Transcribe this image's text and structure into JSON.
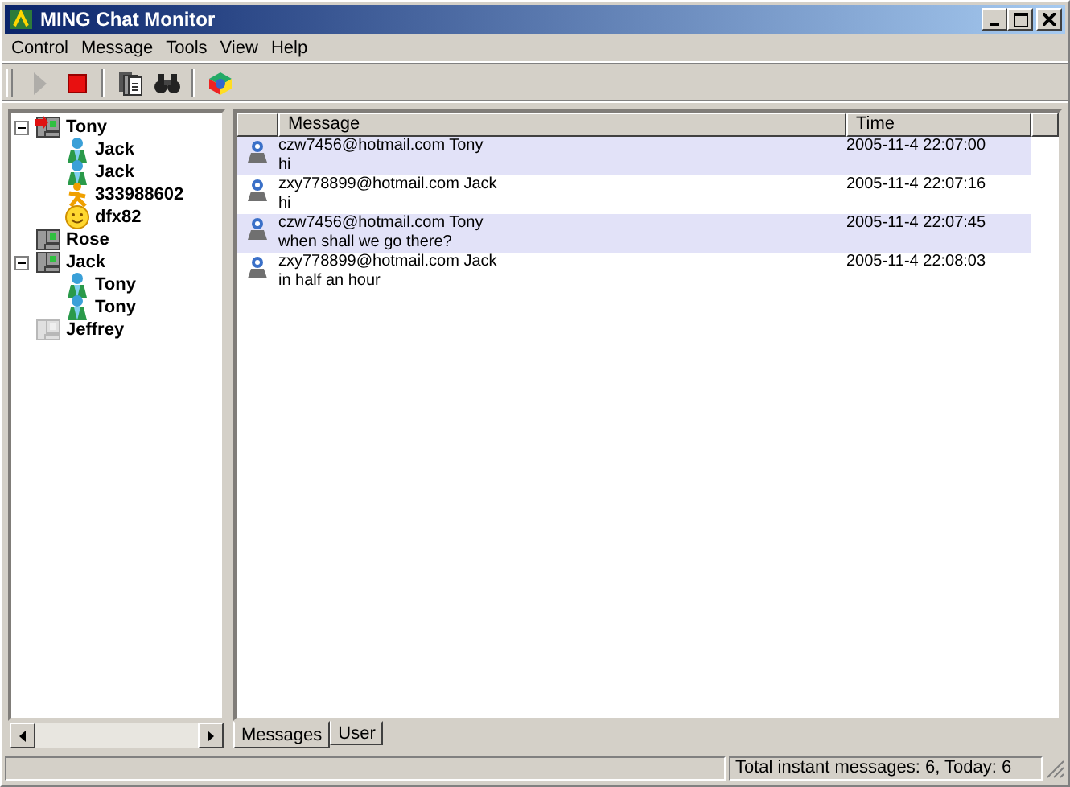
{
  "window": {
    "title": "MING Chat Monitor"
  },
  "menu": [
    "Control",
    "Message",
    "Tools",
    "View",
    "Help"
  ],
  "toolbar": [
    {
      "kind": "play",
      "disabled": true
    },
    {
      "kind": "stop",
      "disabled": false
    },
    {
      "kind": "sep"
    },
    {
      "kind": "pages",
      "disabled": false
    },
    {
      "kind": "find",
      "disabled": false
    },
    {
      "kind": "sep"
    },
    {
      "kind": "cube",
      "disabled": false
    }
  ],
  "tree": [
    {
      "label": "Tony",
      "kind": "station",
      "alert": true,
      "offline": false,
      "expanded": true,
      "children": [
        {
          "label": "Jack",
          "kind": "msn"
        },
        {
          "label": "Jack",
          "kind": "msn"
        },
        {
          "label": "333988602",
          "kind": "aim"
        },
        {
          "label": "dfx82",
          "kind": "smiley"
        }
      ]
    },
    {
      "label": "Rose",
      "kind": "station",
      "alert": false,
      "offline": false
    },
    {
      "label": "Jack",
      "kind": "station",
      "alert": false,
      "offline": false,
      "expanded": true,
      "children": [
        {
          "label": "Tony",
          "kind": "msn"
        },
        {
          "label": "Tony",
          "kind": "msn"
        }
      ]
    },
    {
      "label": "Jeffrey",
      "kind": "station",
      "alert": false,
      "offline": true
    }
  ],
  "table": {
    "columns": [
      "Message",
      "Time"
    ],
    "rows": [
      {
        "sender": "czw7456@hotmail.com Tony",
        "text": "hi",
        "time": "2005-11-4 22:07:00"
      },
      {
        "sender": "zxy778899@hotmail.com Jack",
        "text": "hi",
        "time": "2005-11-4 22:07:16"
      },
      {
        "sender": "czw7456@hotmail.com Tony",
        "text": "when shall we go there?",
        "time": "2005-11-4 22:07:45"
      },
      {
        "sender": "zxy778899@hotmail.com Jack",
        "text": "in half an hour",
        "time": "2005-11-4 22:08:03"
      }
    ]
  },
  "tabs": [
    {
      "label": "Messages",
      "selected": true
    },
    {
      "label": "User",
      "selected": false
    }
  ],
  "status_bar": {
    "text": "Total instant messages: 6, Today: 6"
  }
}
